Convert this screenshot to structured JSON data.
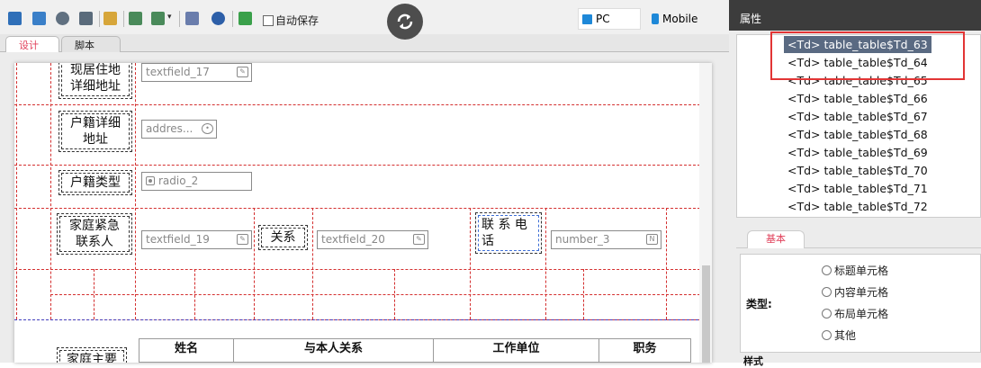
{
  "toolbar": {
    "autosave_label": "自动保存"
  },
  "device": {
    "pc_label": "PC",
    "mobile_label": "Mobile"
  },
  "tabs": {
    "design": "设计",
    "script": "脚本"
  },
  "form": {
    "row1_label_a": "现居住地",
    "row1_label_b": "详细地址",
    "row1_field": "textfield_17",
    "row2_label_a": "户籍详细",
    "row2_label_b": "地址",
    "row2_field": "addres...",
    "row3_label": "户籍类型",
    "row3_field": "radio_2",
    "row4_label_a": "家庭紧急",
    "row4_label_b": "联系人",
    "row4_field": "textfield_19",
    "relation_label": "关系",
    "relation_field": "textfield_20",
    "phone_label_a": "联 系 电",
    "phone_label_b": "话",
    "phone_field": "number_3",
    "family_label": "家庭主要",
    "headers": [
      "姓名",
      "与本人关系",
      "工作单位",
      "职务"
    ]
  },
  "properties": {
    "title": "属性",
    "tree_items": [
      "<Td> table_table$Td_63",
      "<Td> table_table$Td_64",
      "<Td> table_table$Td_65",
      "<Td> table_table$Td_66",
      "<Td> table_table$Td_67",
      "<Td> table_table$Td_68",
      "<Td> table_table$Td_69",
      "<Td> table_table$Td_70",
      "<Td> table_table$Td_71",
      "<Td> table_table$Td_72"
    ],
    "tab_basic": "基本",
    "type_label": "类型:",
    "type_options": [
      "标题单元格",
      "内容单元格",
      "布局单元格",
      "其他"
    ],
    "style_label": "样式"
  }
}
